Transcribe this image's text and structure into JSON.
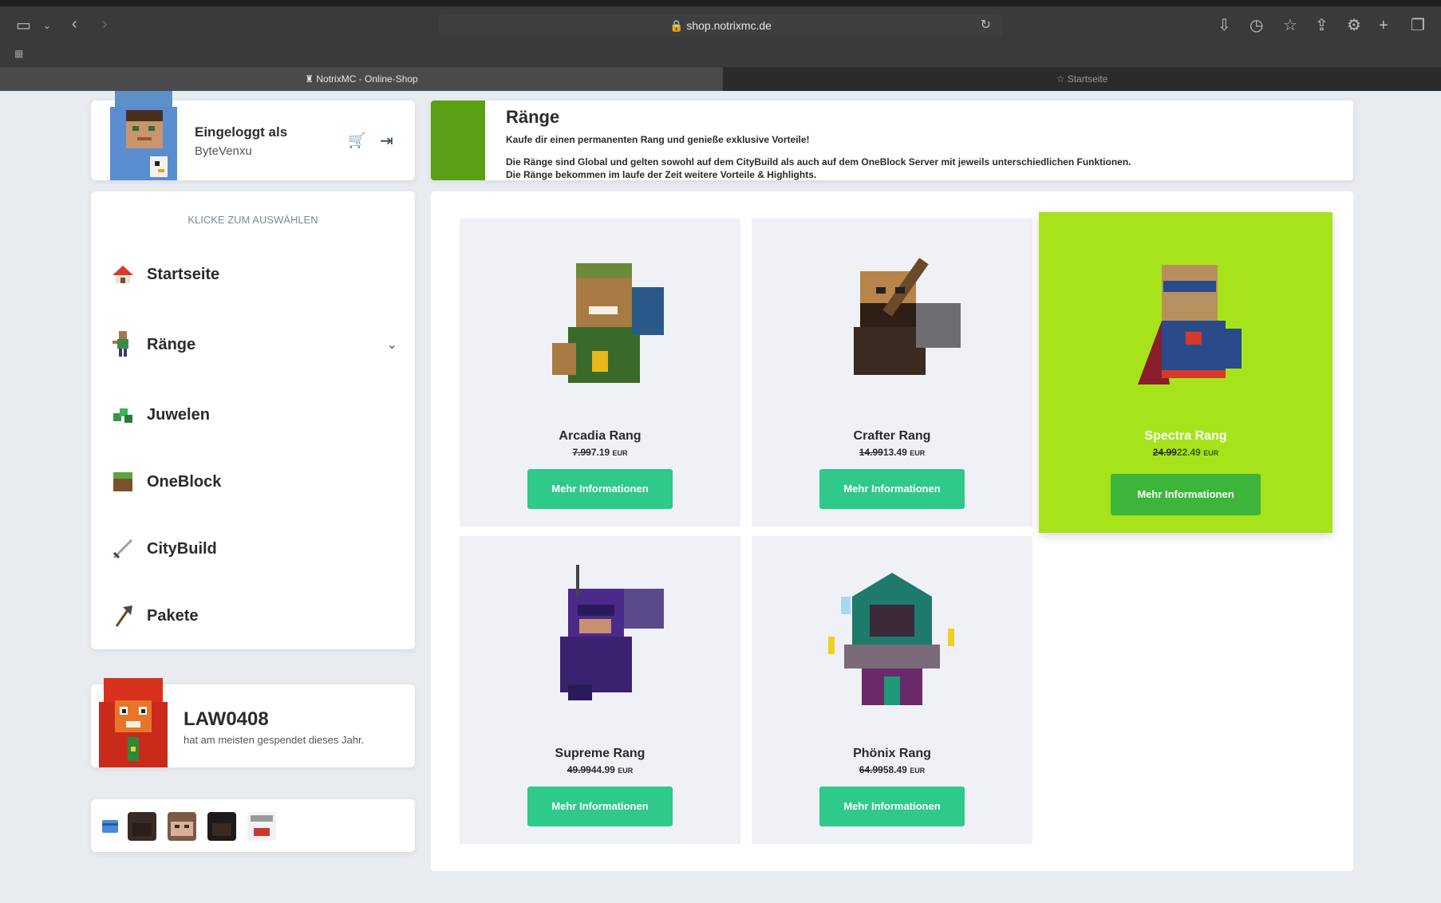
{
  "browser": {
    "url": "shop.notrixmc.de",
    "tabs": [
      {
        "label": "NotrixMC - Online-Shop"
      },
      {
        "label": "Startseite"
      }
    ],
    "bookmarks_icon": "grid-icon"
  },
  "login": {
    "label": "Eingeloggt als",
    "username": "ByteVenxu"
  },
  "nav": {
    "hint": "KLICKE ZUM AUSWÄHLEN",
    "items": [
      {
        "label": "Startseite",
        "icon": "house-icon"
      },
      {
        "label": "Ränge",
        "icon": "character-icon"
      },
      {
        "label": "Juwelen",
        "icon": "gem-icon"
      },
      {
        "label": "OneBlock",
        "icon": "grass-block-icon"
      },
      {
        "label": "CityBuild",
        "icon": "sword-icon"
      },
      {
        "label": "Pakete",
        "icon": "axe-icon"
      }
    ]
  },
  "donor": {
    "name": "LAW0408",
    "subtitle": "hat am meisten gespendet dieses Jahr."
  },
  "banner": {
    "title": "Ränge",
    "line1": "Kaufe dir einen permanenten Rang und genieße exklusive Vorteile!",
    "line2": "Die Ränge sind Global und gelten sowohl auf dem CityBuild als auch auf dem OneBlock Server mit jeweils unterschiedlichen Funktionen.",
    "line3": "Die Ränge bekommen im laufe der Zeit weitere Vorteile & Highlights."
  },
  "products": [
    {
      "name": "Arcadia Rang",
      "old_price": "7.99",
      "price": "7.19",
      "currency": "EUR",
      "button": "Mehr Informationen"
    },
    {
      "name": "Crafter Rang",
      "old_price": "14.99",
      "price": "13.49",
      "currency": "EUR",
      "button": "Mehr Informationen"
    },
    {
      "name": "Spectra Rang",
      "old_price": "24.99",
      "price": "22.49",
      "currency": "EUR",
      "button": "Mehr Informationen"
    },
    {
      "name": "Supreme Rang",
      "old_price": "49.99",
      "price": "44.99",
      "currency": "EUR",
      "button": "Mehr Informationen"
    },
    {
      "name": "Phönix Rang",
      "old_price": "64.99",
      "price": "58.49",
      "currency": "EUR",
      "button": "Mehr Informationen"
    }
  ],
  "colors": {
    "accent_green": "#2fc98a",
    "featured_bg": "#a6e31b",
    "banner_bar": "#5aa015"
  }
}
